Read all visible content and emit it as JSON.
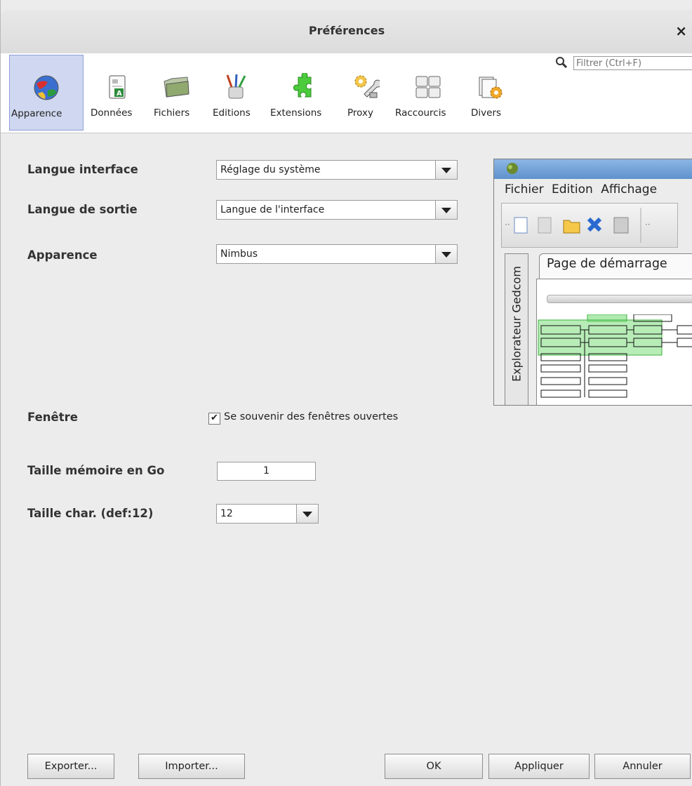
{
  "window": {
    "title": "Préférences",
    "close_glyph": "×"
  },
  "toolbar": {
    "items": [
      {
        "label": "Apparence",
        "icon": "globe-icon",
        "active": true
      },
      {
        "label": "Données",
        "icon": "document-icon"
      },
      {
        "label": "Fichiers",
        "icon": "folder-icon"
      },
      {
        "label": "Editions",
        "icon": "paint-brushes-icon"
      },
      {
        "label": "Extensions",
        "icon": "puzzle-icon"
      },
      {
        "label": "Proxy",
        "icon": "gears-wrench-icon"
      },
      {
        "label": "Raccourcis",
        "icon": "keyboard-keys-icon"
      },
      {
        "label": "Divers",
        "icon": "papers-gear-icon"
      }
    ],
    "filter_placeholder": "Filtrer (Ctrl+F)"
  },
  "form": {
    "langue_interface": {
      "label": "Langue interface",
      "value": "Réglage du système"
    },
    "langue_sortie": {
      "label": "Langue de sortie",
      "value": "Langue de l'interface"
    },
    "apparence": {
      "label": "Apparence",
      "value": "Nimbus"
    },
    "fenetre": {
      "label": "Fenêtre",
      "checkbox_label": "Se souvenir des fenêtres ouvertes",
      "checked": true,
      "check_glyph": "✔"
    },
    "memoire": {
      "label": "Taille mémoire en Go",
      "value": "1"
    },
    "char": {
      "label": "Taille char. (def:12)",
      "value": "12"
    }
  },
  "preview": {
    "menu": [
      "Fichier",
      "Edition",
      "Affichage"
    ],
    "side_tab": "Explorateur Gedcom",
    "tab": "Page de démarrage"
  },
  "buttons": {
    "export": "Exporter...",
    "import": "Importer...",
    "ok": "OK",
    "apply": "Appliquer",
    "cancel": "Annuler"
  },
  "colors": {
    "active_tab": "#cfd8f0",
    "tree_green": "#7cdc7c"
  }
}
